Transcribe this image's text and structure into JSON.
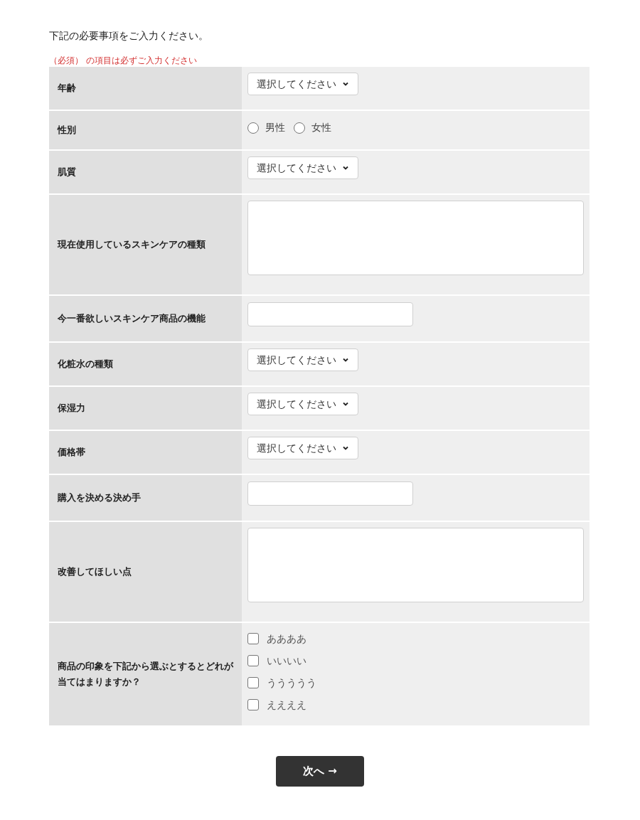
{
  "intro": "下記の必要事項をご入力ください。",
  "required_note": "（必須） の項目は必ずご入力ください",
  "rows": [
    {
      "label": "年齢",
      "kind": "select",
      "value": "選択してください"
    },
    {
      "label": "性別",
      "kind": "radio",
      "options": [
        {
          "label": "男性",
          "selected": false
        },
        {
          "label": "女性",
          "selected": false
        }
      ]
    },
    {
      "label": "肌質",
      "kind": "select",
      "value": "選択してください"
    },
    {
      "label": "現在使用しているスキンケアの種類",
      "kind": "textarea"
    },
    {
      "label": "今一番欲しいスキンケア商品の機能",
      "kind": "text"
    },
    {
      "label": "化粧水の種類",
      "kind": "select",
      "value": "選択してください"
    },
    {
      "label": "保湿力",
      "kind": "select",
      "value": "選択してください"
    },
    {
      "label": "価格帯",
      "kind": "select",
      "value": "選択してください"
    },
    {
      "label": "購入を決める決め手",
      "kind": "text"
    },
    {
      "label": "改善してほしい点",
      "kind": "textarea"
    },
    {
      "label": "商品の印象を下記から選ぶとするとどれが当てはまりますか？",
      "kind": "checkbox",
      "options": [
        {
          "label": "ああああ",
          "checked": false
        },
        {
          "label": "いいいい",
          "checked": false
        },
        {
          "label": "ううううう",
          "checked": false
        },
        {
          "label": "ええええ",
          "checked": false
        }
      ]
    }
  ],
  "next_button": "次へ →"
}
